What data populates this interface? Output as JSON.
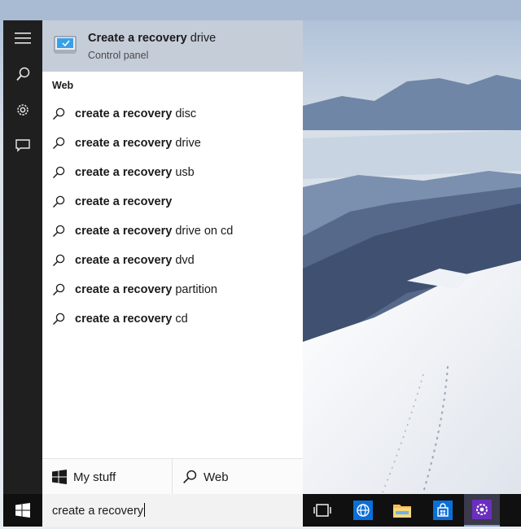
{
  "best_match": {
    "title_bold": "Create a recovery",
    "title_rest": " drive",
    "subtitle": "Control panel",
    "icon": "recovery-drive-icon"
  },
  "section_label": "Web",
  "suggestions": [
    {
      "bold": "create a recovery",
      "rest": " disc"
    },
    {
      "bold": "create a recovery",
      "rest": " drive"
    },
    {
      "bold": "create a recovery",
      "rest": " usb"
    },
    {
      "bold": "create a recovery",
      "rest": ""
    },
    {
      "bold": "create a recovery",
      "rest": " drive on cd"
    },
    {
      "bold": "create a recovery",
      "rest": " dvd"
    },
    {
      "bold": "create a recovery",
      "rest": " partition"
    },
    {
      "bold": "create a recovery",
      "rest": " cd"
    }
  ],
  "filters": {
    "my_stuff": "My stuff",
    "web": "Web"
  },
  "search": {
    "value": "create a recovery"
  },
  "colors": {
    "rail": "#1f1f1f",
    "best_match_bg": "#c5cdd9",
    "taskbar": "#101010",
    "accent_purple": "#6b2fbf",
    "accent_blue": "#0a6fd8"
  }
}
